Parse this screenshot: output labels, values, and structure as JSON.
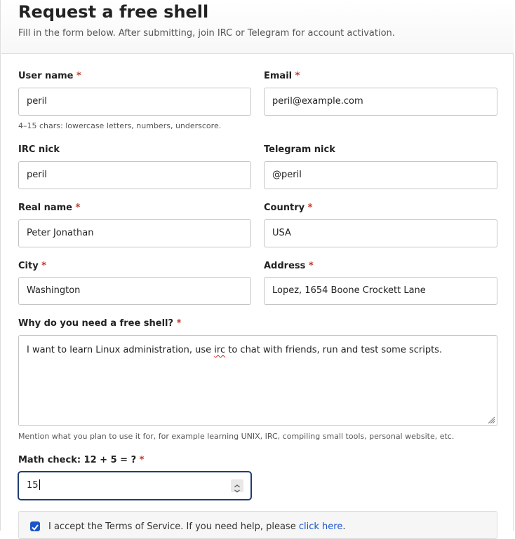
{
  "header": {
    "title": "Request a free shell",
    "subtitle": "Fill in the form below. After submitting, join IRC or Telegram for account activation."
  },
  "form": {
    "required_marker": "*",
    "username": {
      "label": "User name",
      "value": "peril",
      "hint": "4–15 chars: lowercase letters, numbers, underscore."
    },
    "email": {
      "label": "Email",
      "value": "peril@example.com"
    },
    "irc_nick": {
      "label": "IRC nick",
      "value": "peril"
    },
    "telegram_nick": {
      "label": "Telegram nick",
      "value": "@peril"
    },
    "real_name": {
      "label": "Real name",
      "value": "Peter Jonathan"
    },
    "country": {
      "label": "Country",
      "value": "USA"
    },
    "city": {
      "label": "City",
      "value": "Washington"
    },
    "address": {
      "label": "Address",
      "value": "Lopez, 1654 Boone Crockett Lane"
    },
    "reason": {
      "label": "Why do you need a free shell?",
      "value_before": "I want to learn Linux administration, use ",
      "value_misspelled": "irc",
      "value_after": " to chat with friends, run and test some scripts.",
      "hint": "Mention what you plan to use it for, for example learning UNIX, IRC, compiling small tools, personal website, etc."
    },
    "math": {
      "label": "Math check: 12 + 5 = ?",
      "value": "15"
    },
    "terms": {
      "checked": true,
      "text": "I accept the Terms of Service. If you need help, please ",
      "link": "click here",
      "text_end": "."
    }
  },
  "colors": {
    "required": "#c0392b",
    "accent": "#1a56c9",
    "focus_border": "#1f3d73"
  }
}
